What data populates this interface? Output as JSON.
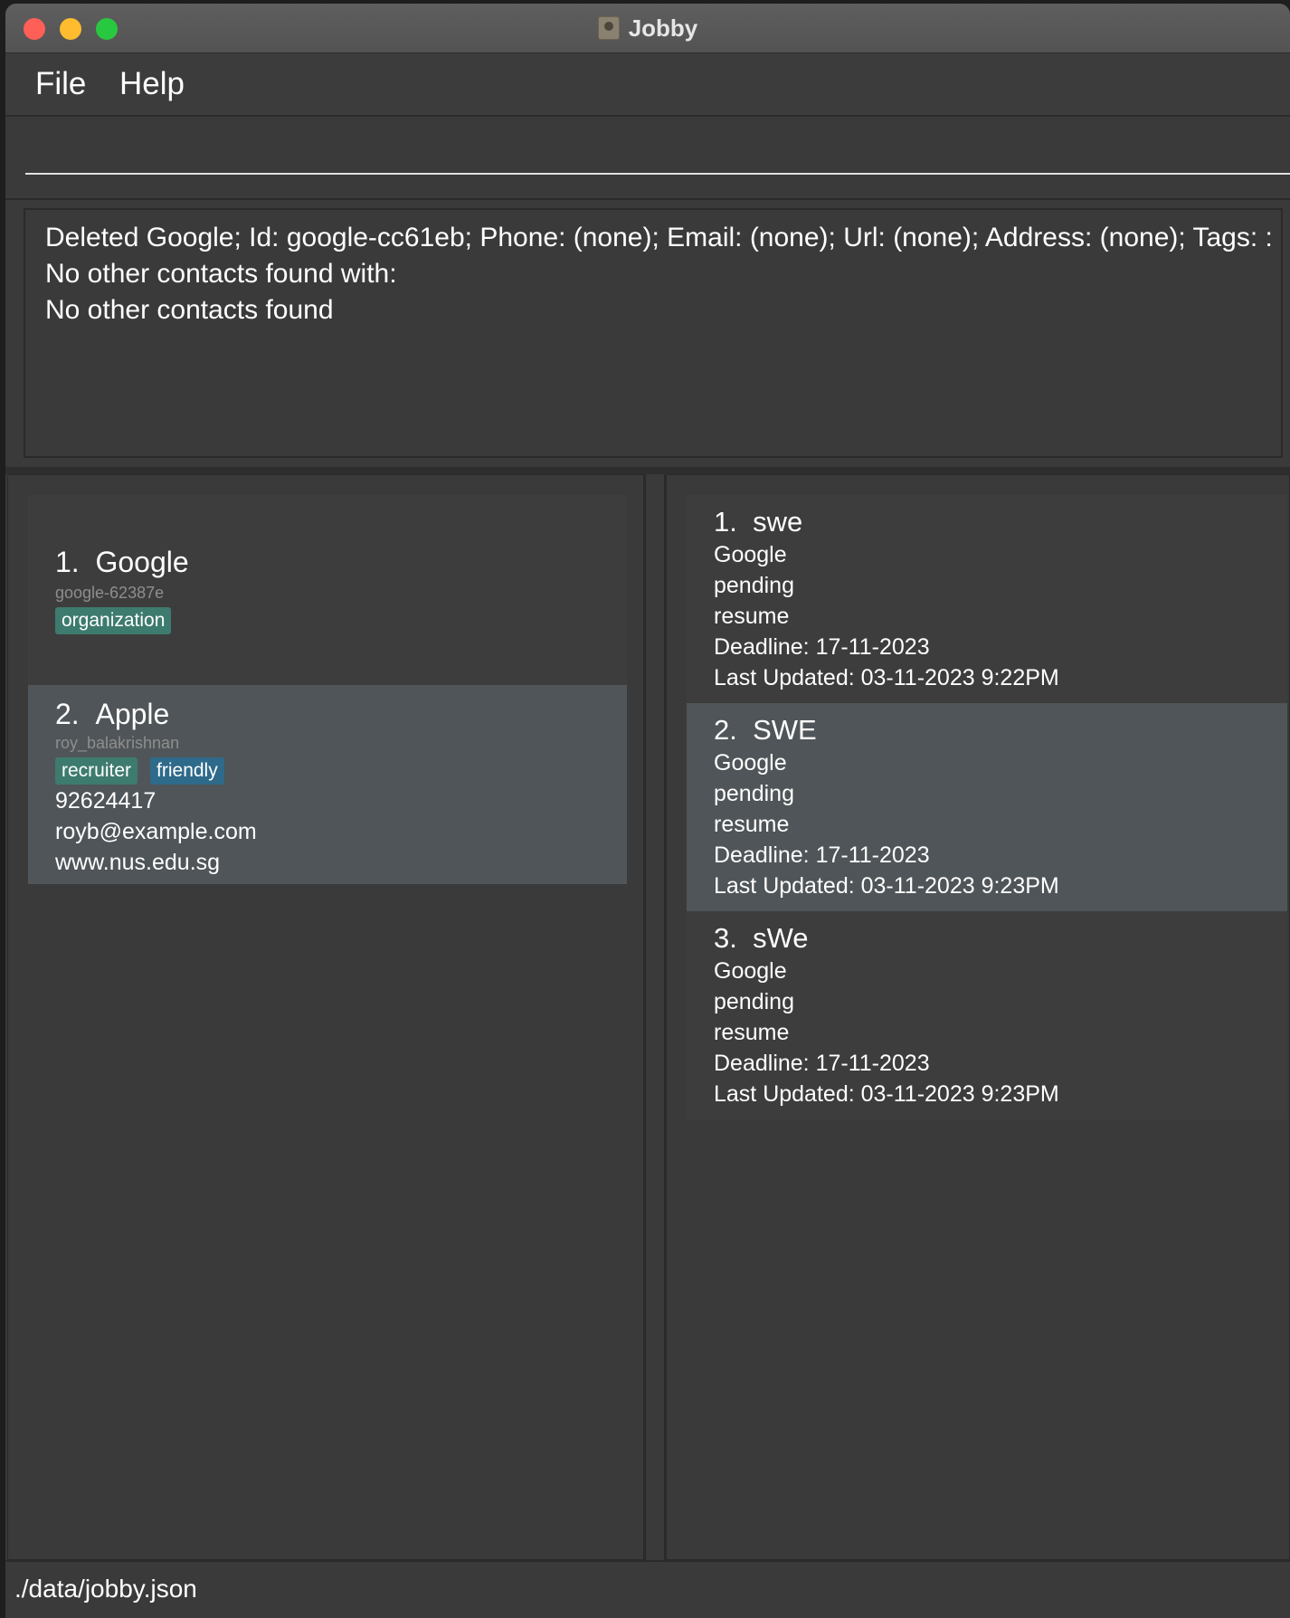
{
  "window": {
    "title": "Jobby"
  },
  "menu": {
    "file": "File",
    "help": "Help"
  },
  "command": {
    "value": "",
    "placeholder": ""
  },
  "result": {
    "lines": [
      "Deleted Google; Id: google-cc61eb; Phone: (none); Email: (none); Url: (none); Address: (none); Tags: :",
      "No other contacts found with:",
      "No other contacts found"
    ]
  },
  "contacts": [
    {
      "index": "1.",
      "name": "Google",
      "id": "google-62387e",
      "tags": [
        "organization"
      ],
      "phone": "",
      "email": "",
      "url": ""
    },
    {
      "index": "2.",
      "name": "Apple",
      "id": "roy_balakrishnan",
      "tags": [
        "recruiter",
        "friendly"
      ],
      "phone": "92624417",
      "email": "royb@example.com",
      "url": "www.nus.edu.sg"
    }
  ],
  "jobs": [
    {
      "index": "1.",
      "title": "swe",
      "company": "Google",
      "status": "pending",
      "stage": "resume",
      "deadline": "Deadline: 17-11-2023",
      "updated": "Last Updated: 03-11-2023 9:22PM"
    },
    {
      "index": "2.",
      "title": "SWE",
      "company": "Google",
      "status": "pending",
      "stage": "resume",
      "deadline": "Deadline: 17-11-2023",
      "updated": "Last Updated: 03-11-2023 9:23PM"
    },
    {
      "index": "3.",
      "title": "sWe",
      "company": "Google",
      "status": "pending",
      "stage": "resume",
      "deadline": "Deadline: 17-11-2023",
      "updated": "Last Updated: 03-11-2023 9:23PM"
    }
  ],
  "status_bar": {
    "path": "./data/jobby.json"
  },
  "colors": {
    "background": "#3a3a3a",
    "selected_card": "#4f5558",
    "tag_green": "#3e7b6f",
    "tag_blue": "#2e6a8a"
  }
}
